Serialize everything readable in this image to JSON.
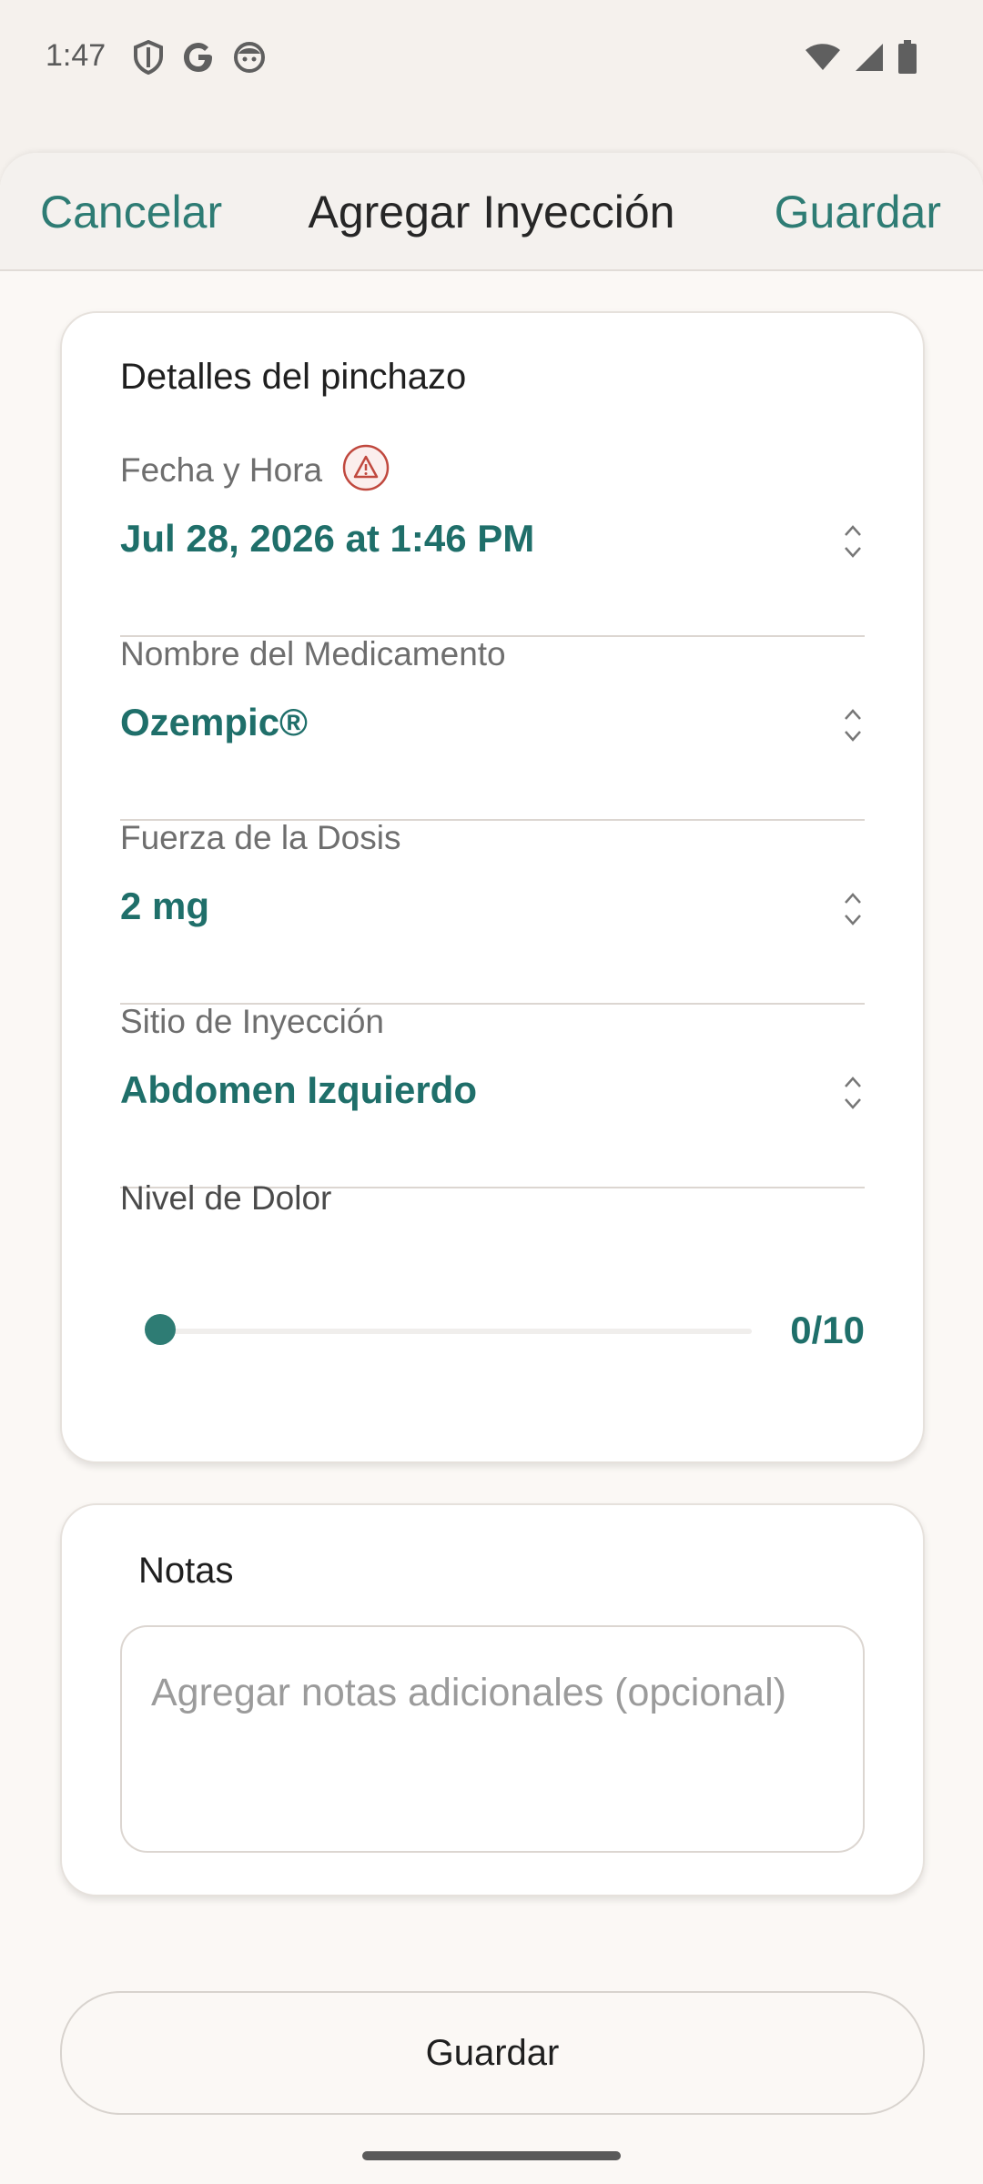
{
  "status_bar": {
    "time": "1:47",
    "left_icons": [
      "shield-icon",
      "google-icon",
      "face-icon"
    ],
    "right_icons": [
      "wifi-icon",
      "signal-icon",
      "battery-icon"
    ]
  },
  "header": {
    "cancel_label": "Cancelar",
    "title": "Agregar Inyección",
    "save_label": "Guardar"
  },
  "details": {
    "title": "Detalles del pinchazo",
    "date_time": {
      "label": "Fecha y Hora",
      "value": "Jul 28, 2026 at 1:46 PM",
      "warning_icon": "warning-icon"
    },
    "medication": {
      "label": "Nombre del Medicamento",
      "value": "Ozempic®"
    },
    "dose": {
      "label": "Fuerza de la Dosis",
      "value": "2 mg"
    },
    "site": {
      "label": "Sitio de Inyección",
      "value": "Abdomen Izquierdo"
    },
    "pain": {
      "label": "Nivel de Dolor",
      "value": 0,
      "max": 10,
      "display": "0/10"
    }
  },
  "notes": {
    "title": "Notas",
    "placeholder": "Agregar notas adicionales (opcional)",
    "value": ""
  },
  "footer": {
    "save_label": "Guardar"
  },
  "colors": {
    "accent": "#2e7c74",
    "value_text": "#1f6f6a",
    "warning": "#c0483e"
  }
}
